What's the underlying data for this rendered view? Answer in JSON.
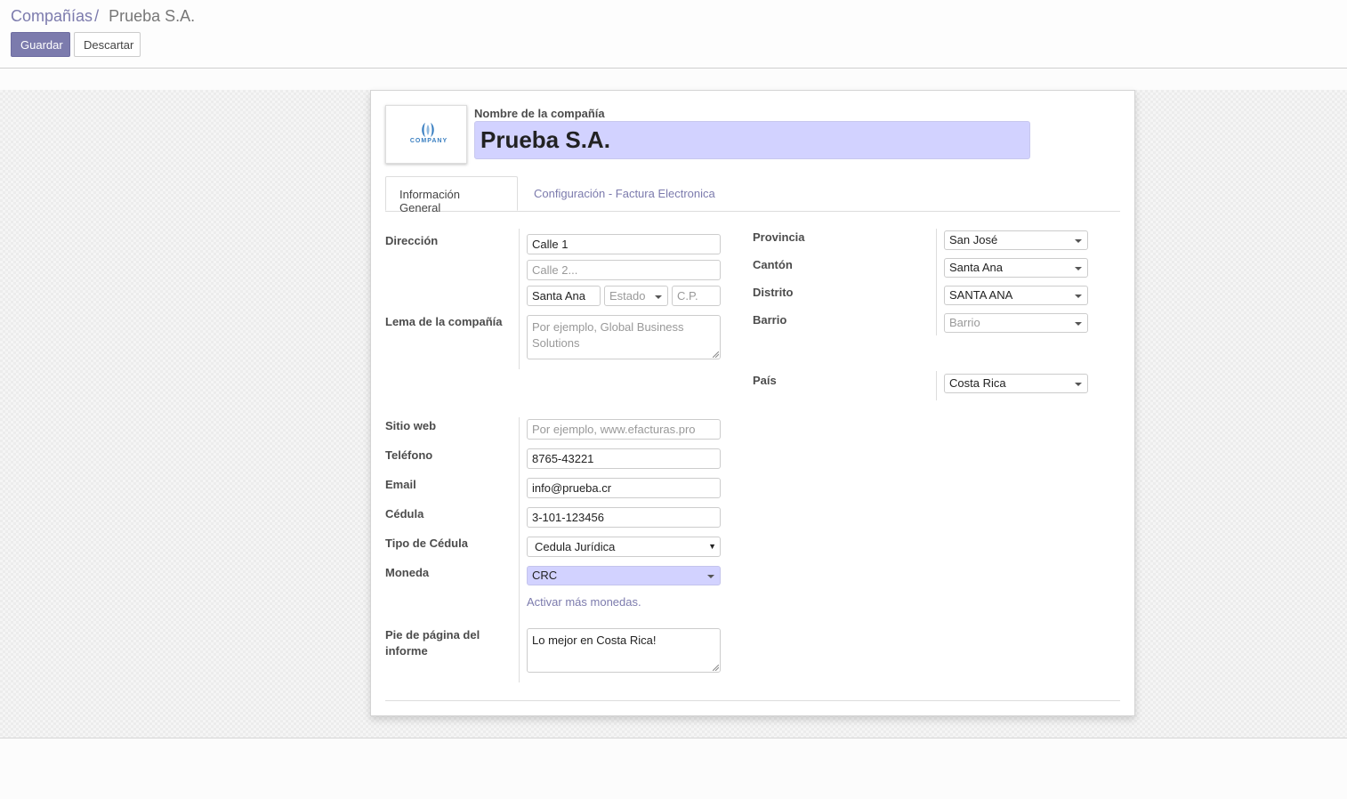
{
  "breadcrumb": {
    "parent": "Compañías",
    "separator": "/",
    "current": "Prueba S.A."
  },
  "buttons": {
    "save": "Guardar",
    "discard": "Descartar"
  },
  "company": {
    "name_label": "Nombre de la compañía",
    "name": "Prueba S.A.",
    "logo_text": "COMPANY"
  },
  "tabs": [
    "Información General",
    "Configuración - Factura Electronica"
  ],
  "left": {
    "address_label": "Dirección",
    "street": "Calle 1",
    "street2_placeholder": "Calle 2...",
    "city": "Santa Ana",
    "state_placeholder": "Estado",
    "zip_placeholder": "C.P.",
    "slogan_label": "Lema de la compañía",
    "slogan_placeholder": "Por ejemplo, Global Business Solutions",
    "website_label": "Sitio web",
    "website_placeholder": "Por ejemplo, www.efacturas.pro",
    "phone_label": "Teléfono",
    "phone": "8765-43221",
    "email_label": "Email",
    "email": "info@prueba.cr",
    "id_label": "Cédula",
    "id_value": "3-101-123456",
    "id_type_label": "Tipo de Cédula",
    "id_type": "Cedula Jurídica",
    "currency_label": "Moneda",
    "currency": "CRC",
    "more_currencies": "Activar más monedas.",
    "footer_label": "Pie de página del informe",
    "footer": "Lo mejor en Costa Rica!"
  },
  "right": {
    "province_label": "Provincia",
    "province": "San José",
    "canton_label": "Cantón",
    "canton": "Santa Ana",
    "district_label": "Distrito",
    "district": "SANTA ANA",
    "barrio_label": "Barrio",
    "barrio_placeholder": "Barrio",
    "country_label": "País",
    "country": "Costa Rica"
  },
  "colors": {
    "accent": "#7c7bad",
    "highlight": "#d2d2ff"
  }
}
